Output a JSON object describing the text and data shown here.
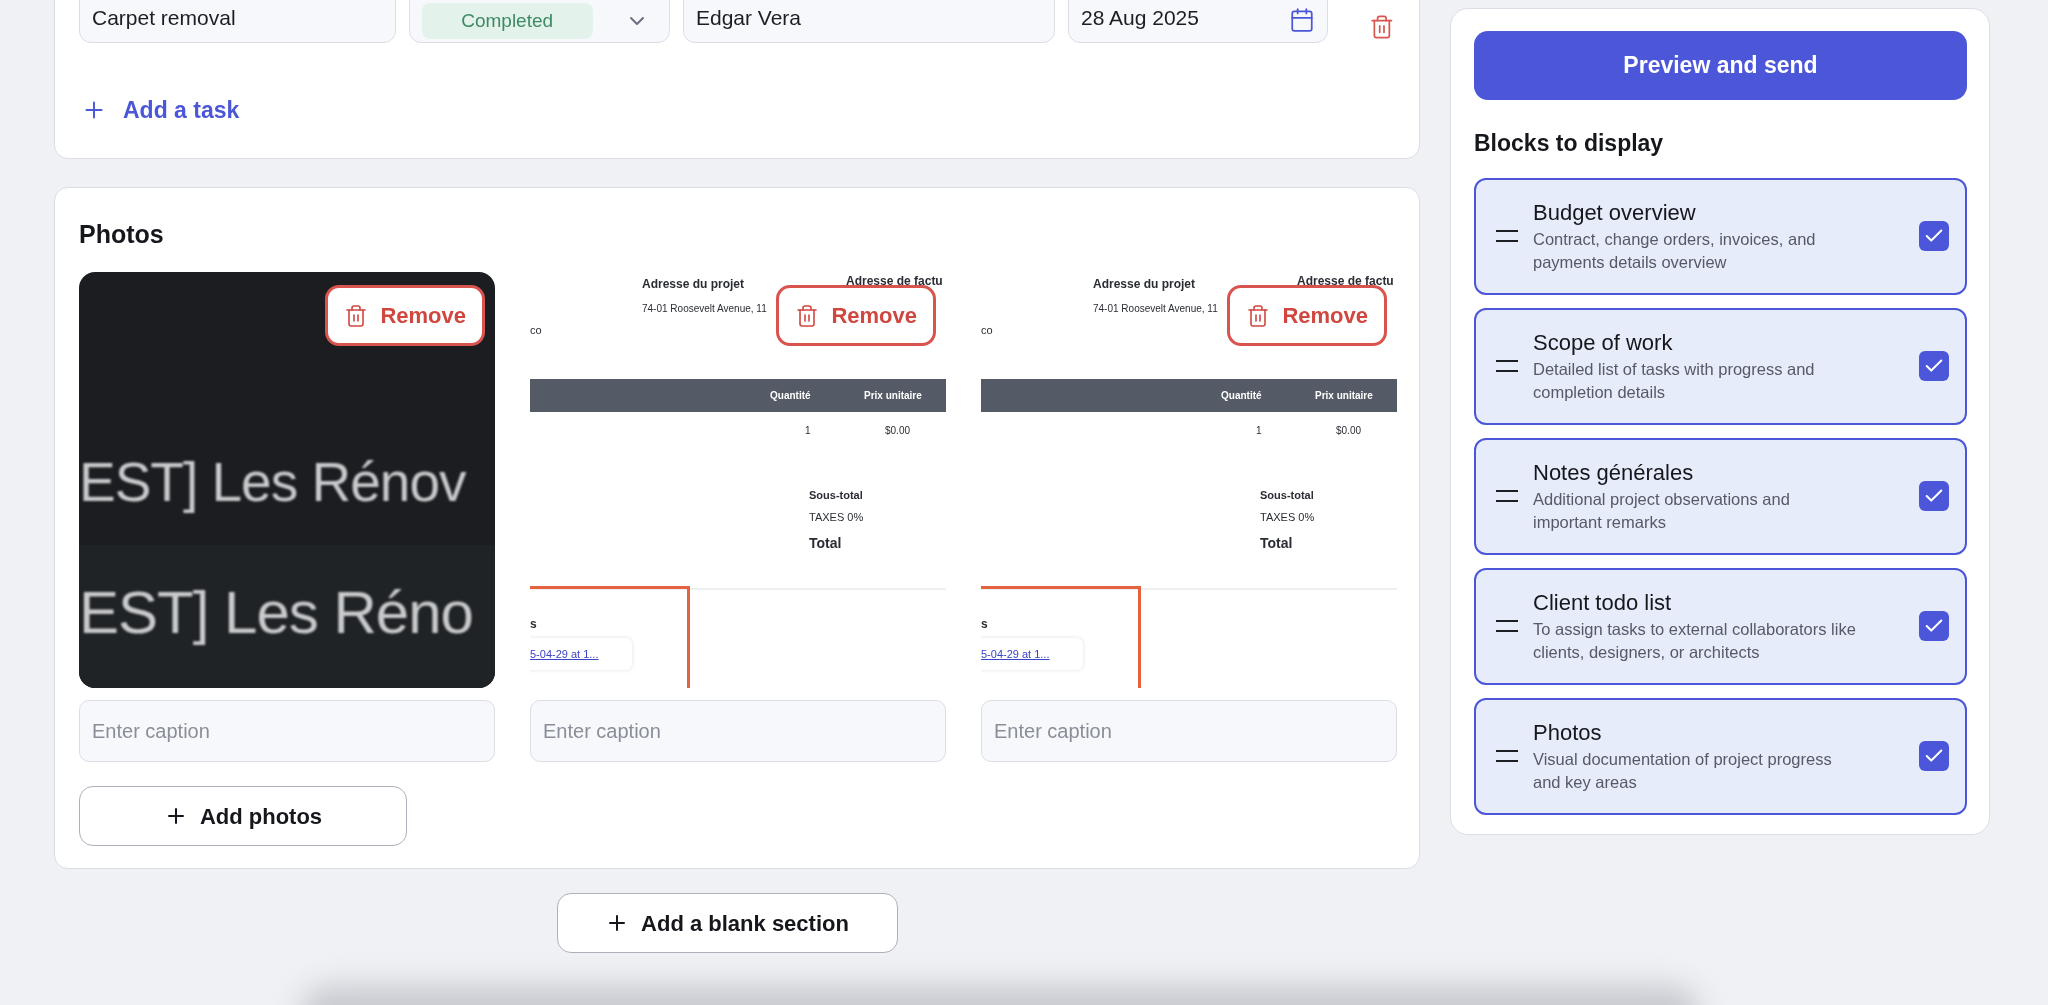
{
  "tasks": [
    {
      "name": "Carpet removal",
      "status": "Completed",
      "assignee": "Edgar Vera",
      "due_date": "28 Aug 2025"
    }
  ],
  "add_task": "Add a task",
  "photos": {
    "title": "Photos",
    "items": [
      {
        "kind": "dark_screenshot",
        "lines": [
          "EST] Les Rénov",
          "EST] Les Réno"
        ],
        "remove": "Remove",
        "caption_placeholder": "Enter caption"
      },
      {
        "kind": "invoice_screenshot",
        "project_label": "Adresse du projet",
        "billing_label": "Adresse de factu",
        "address": "74-01 Roosevelt Avenue, 11",
        "fragment": "co",
        "col_qty": "Quantité",
        "col_price": "Prix unitaire",
        "qty": "1",
        "price": "$0.00",
        "subtotal": "Sous-total",
        "taxes": "TAXES 0%",
        "total": "Total",
        "section_fragment": "s",
        "link": "5-04-29 at 1...",
        "remove": "Remove",
        "caption_placeholder": "Enter caption"
      },
      {
        "kind": "invoice_screenshot",
        "project_label": "Adresse du projet",
        "billing_label": "Adresse de factu",
        "address": "74-01 Roosevelt Avenue, 11",
        "fragment": "co",
        "col_qty": "Quantité",
        "col_price": "Prix unitaire",
        "qty": "1",
        "price": "$0.00",
        "subtotal": "Sous-total",
        "taxes": "TAXES 0%",
        "total": "Total",
        "section_fragment": "s",
        "link": "5-04-29 at 1...",
        "remove": "Remove",
        "caption_placeholder": "Enter caption"
      }
    ],
    "add_photos": "Add photos"
  },
  "add_section": "Add a blank section",
  "sidebar": {
    "preview_button": "Preview and send",
    "blocks_title": "Blocks to display",
    "blocks": [
      {
        "title": "Budget overview",
        "description": "Contract, change orders, invoices, and payments details overview",
        "checked": true
      },
      {
        "title": "Scope of work",
        "description": "Detailed list of tasks with progress and completion details",
        "checked": true
      },
      {
        "title": "Notes générales",
        "description": "Additional project observations and important remarks",
        "checked": true
      },
      {
        "title": "Client todo list",
        "description": "To assign tasks to external collaborators like clients, designers, or architects",
        "checked": true
      },
      {
        "title": "Photos",
        "description": "Visual documentation of project progress and key areas",
        "checked": true
      }
    ]
  }
}
